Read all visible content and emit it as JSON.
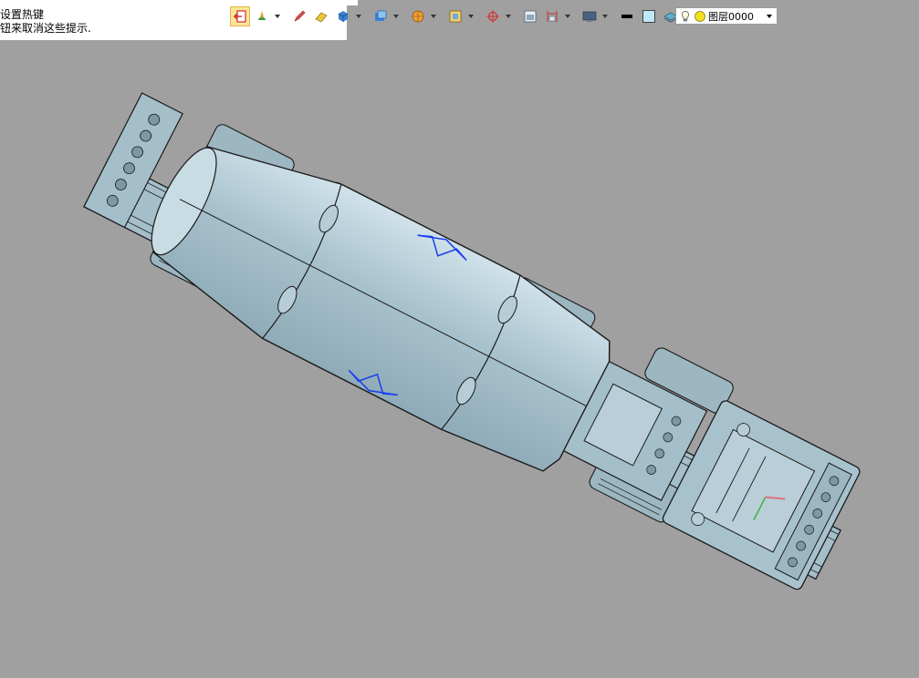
{
  "hint": {
    "line1": "设置热键",
    "line2": "钮来取消这些提示."
  },
  "toolbar": {
    "buttons": [
      {
        "name": "exit-tool-icon"
      },
      {
        "name": "paint-tool-icon"
      },
      {
        "name": "pencil-icon"
      },
      {
        "name": "eraser-icon"
      },
      {
        "name": "solid-box-icon"
      },
      {
        "name": "view-cube-icon"
      },
      {
        "name": "render-sphere-icon"
      },
      {
        "name": "frame-select-icon"
      },
      {
        "name": "snap-target-icon"
      },
      {
        "name": "section-view-icon"
      },
      {
        "name": "dimension-icon"
      },
      {
        "name": "display-mode-icon"
      },
      {
        "name": "line-color-icon"
      },
      {
        "name": "fill-color-icon"
      },
      {
        "name": "layer-stack-icon"
      }
    ]
  },
  "layer": {
    "name": "图层0000"
  },
  "colors": {
    "background": "#a0a0a0",
    "model_fill": "#a9c3cf",
    "model_highlight": "#c4d8e0",
    "model_edge": "#1a1a1a",
    "selection_edge": "#1a3cf0",
    "active_button": "#fde49a"
  }
}
